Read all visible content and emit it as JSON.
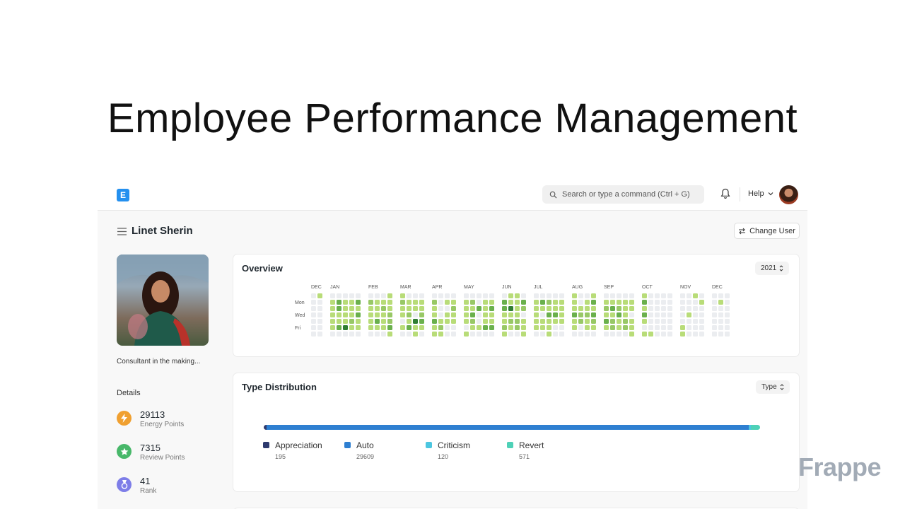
{
  "slide": {
    "title": "Employee Performance Management",
    "brand": "Frappe"
  },
  "navbar": {
    "logo_letter": "E",
    "search_placeholder": "Search or type a command (Ctrl + G)",
    "help_label": "Help"
  },
  "profile": {
    "name": "Linet Sherin",
    "change_user_label": "Change User",
    "bio": "Consultant in the making...",
    "details_heading": "Details",
    "stats": [
      {
        "value": "29113",
        "label": "Energy Points",
        "icon": "lightning-icon",
        "color": "#f0a030"
      },
      {
        "value": "7315",
        "label": "Review Points",
        "icon": "star-icon",
        "color": "#48b86a"
      },
      {
        "value": "41",
        "label": "Rank",
        "icon": "medal-icon",
        "color": "#7e7ee8"
      }
    ]
  },
  "overview": {
    "title": "Overview",
    "year": "2021",
    "months": [
      "DEC",
      "JAN",
      "FEB",
      "MAR",
      "APR",
      "MAY",
      "JUN",
      "JUL",
      "AUG",
      "SEP",
      "OCT",
      "NOV",
      "DEC"
    ],
    "day_labels": [
      "Mon",
      "Wed",
      "Fri"
    ],
    "colors": [
      "#ebedf0",
      "#b8dc78",
      "#98c866",
      "#6ab04c",
      "#2f7d32"
    ]
  },
  "type_distribution": {
    "title": "Type Distribution",
    "select_label": "Type",
    "items": [
      {
        "name": "Appreciation",
        "value": "195",
        "color": "#2d3a6e"
      },
      {
        "name": "Auto",
        "value": "29609",
        "color": "#2e7fd1"
      },
      {
        "name": "Criticism",
        "value": "120",
        "color": "#4cc6e0"
      },
      {
        "name": "Revert",
        "value": "571",
        "color": "#4ed1b7"
      }
    ]
  }
}
